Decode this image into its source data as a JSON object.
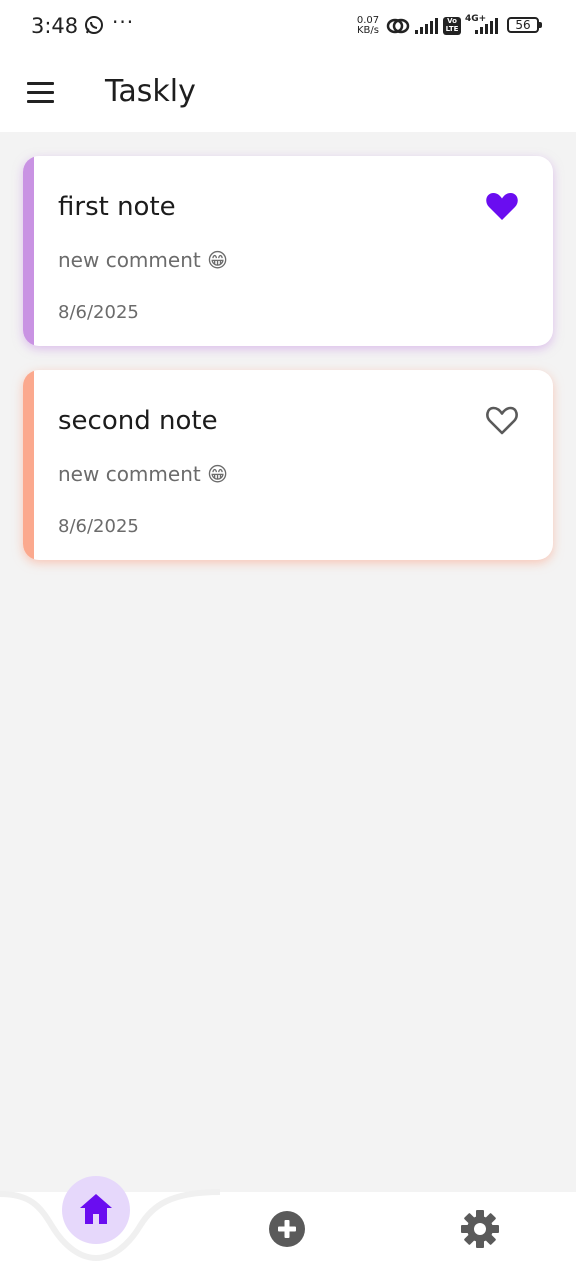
{
  "status_bar": {
    "time": "3:48",
    "dots": "···",
    "speed_value": "0.07",
    "speed_unit": "KB/s",
    "volte_top": "Vo",
    "volte_bottom": "LTE",
    "network": "4G+",
    "battery": "56"
  },
  "app": {
    "title": "Taskly"
  },
  "notes": [
    {
      "title": "first note",
      "comment": "new comment 😁",
      "date": "8/6/2025",
      "favorite": true,
      "accent": "#c993e3"
    },
    {
      "title": "second note",
      "comment": "new comment 😁",
      "date": "8/6/2025",
      "favorite": false,
      "accent": "#fba98e"
    }
  ],
  "icons": {
    "menu": "hamburger-menu-icon",
    "favorite_filled": "heart-filled-icon",
    "favorite_outline": "heart-outline-icon",
    "home": "home-icon",
    "add": "add-circle-icon",
    "settings": "gear-icon"
  },
  "colors": {
    "accent": "#6a0df0",
    "home_bg": "#e6d8fb",
    "icon_gray": "#5a5a5a"
  }
}
